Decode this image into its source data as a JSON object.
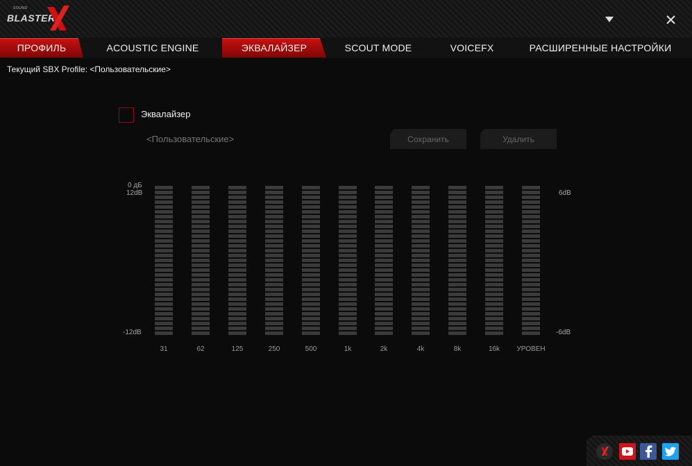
{
  "app": {
    "logo_small": "SOUND",
    "logo_word": "BLASTER",
    "accent": "#c91111"
  },
  "titlebar": {
    "minimize_icon": "chevron-down-icon",
    "close_icon": "close-icon"
  },
  "tabs": [
    {
      "label": "ПРОФИЛЬ",
      "active": true
    },
    {
      "label": "ACOUSTIC ENGINE",
      "active": false
    },
    {
      "label": "ЭКВАЛАЙЗЕР",
      "active": true
    },
    {
      "label": "SCOUT MODE",
      "active": false
    },
    {
      "label": "VOICEFX",
      "active": false
    },
    {
      "label": "РАСШИРЕННЫЕ НАСТРОЙКИ",
      "active": false
    }
  ],
  "profile": {
    "current": "Текущий SBX Profile: <Пользовательские>"
  },
  "equalizer": {
    "enabled_label": "Эквалайзер",
    "enabled": false,
    "preset_name": "<Пользовательские>",
    "save_label": "Сохранить",
    "delete_label": "Удалить",
    "left_axis": {
      "top": "0 дБ",
      "top2": "12dB",
      "bottom": "-12dB"
    },
    "right_axis": {
      "top": "6dB",
      "bottom": "-6dB"
    },
    "bands": [
      "31",
      "62",
      "125",
      "250",
      "500",
      "1k",
      "2k",
      "4k",
      "8k",
      "16k",
      "УРОВЕН"
    ]
  },
  "social": {
    "icons": [
      "soundblaster-x-icon",
      "youtube-icon",
      "facebook-icon",
      "twitter-icon"
    ]
  }
}
